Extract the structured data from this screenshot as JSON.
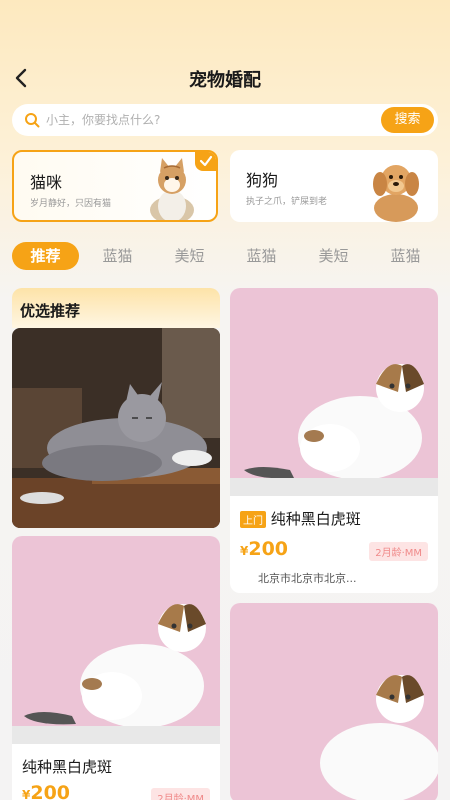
{
  "header": {
    "title": "宠物婚配"
  },
  "search": {
    "placeholder": "小主，你要找点什么?",
    "button_label": "搜索"
  },
  "categories": [
    {
      "title": "猫咪",
      "subtitle": "岁月静好，只因有猫",
      "selected": true
    },
    {
      "title": "狗狗",
      "subtitle": "执子之爪，铲屎到老",
      "selected": false
    }
  ],
  "tabs": [
    "推荐",
    "蓝猫",
    "美短",
    "蓝猫",
    "美短",
    "蓝猫"
  ],
  "recommend": {
    "label": "优选推荐"
  },
  "pets": [
    {
      "tag": "上门",
      "name": "纯种黑白虎斑",
      "price_symbol": "¥",
      "price": "200",
      "age": "2月龄·MM",
      "address": "北京市北京市北京..."
    },
    {
      "name": "纯种黑白虎斑",
      "price_symbol": "¥",
      "price": "200",
      "age": "2月龄·MM"
    }
  ],
  "colors": {
    "accent": "#f6a316",
    "photo_bg": "#ecc4d6",
    "age_badge_bg": "#fde4e4"
  }
}
